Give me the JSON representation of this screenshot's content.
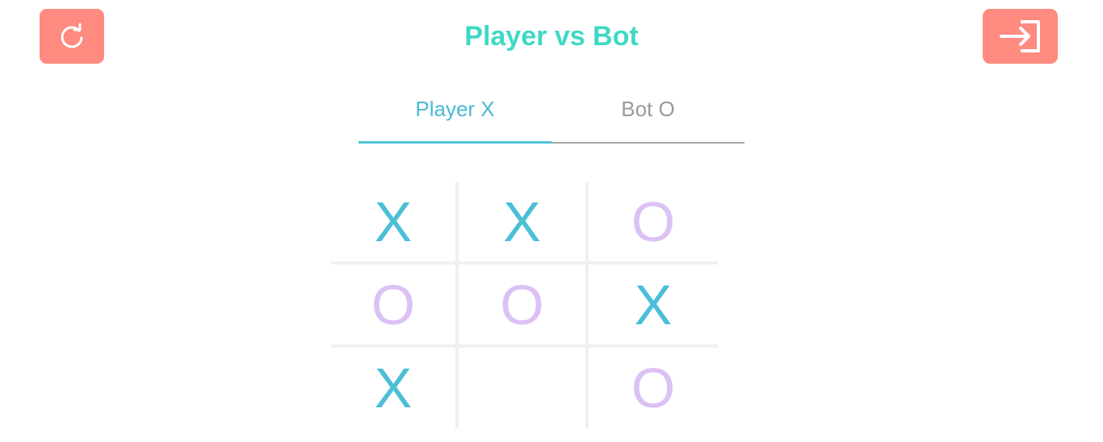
{
  "header": {
    "title": "Player vs Bot",
    "restart_icon": "restart-icon",
    "exit_icon": "exit-icon"
  },
  "colors": {
    "title": "#3fd9c5",
    "button_bg": "#ff8a80",
    "x_mark": "#4bbfd7",
    "o_mark": "#dcc1f5",
    "active_tab": "#4ab9d3",
    "inactive_tab": "#9a9a9a"
  },
  "tabs": [
    {
      "label": "Player X",
      "active": true
    },
    {
      "label": "Bot O",
      "active": false
    }
  ],
  "board": {
    "cells": [
      "X",
      "X",
      "O",
      "O",
      "O",
      "X",
      "X",
      "",
      "O"
    ]
  }
}
